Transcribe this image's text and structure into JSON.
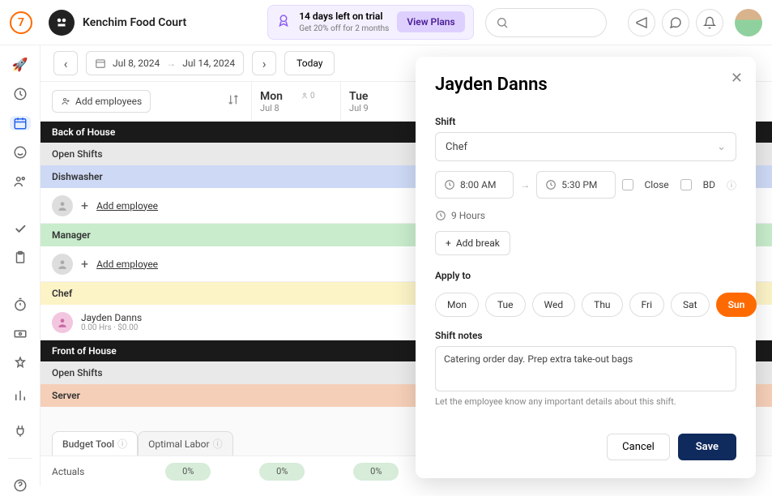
{
  "brand": "Kenchim Food Court",
  "trial": {
    "line1": "14 days left on trial",
    "line2": "Get 20% off for 2 months",
    "cta": "View Plans"
  },
  "date_range": {
    "from": "Jul 8, 2024",
    "to": "Jul 14, 2024"
  },
  "today_label": "Today",
  "add_employees_label": "Add employees",
  "days": [
    {
      "name": "Mon",
      "date": "Jul 8",
      "count": "0"
    },
    {
      "name": "Tue",
      "date": "Jul 9",
      "count": ""
    }
  ],
  "sections": {
    "back": "Back of House",
    "open": "Open Shifts",
    "dish": "Dishwasher",
    "mgr": "Manager",
    "chef": "Chef",
    "front": "Front of House",
    "srv": "Server"
  },
  "add_employee_link": "Add employee",
  "employee": {
    "name": "Jayden Danns",
    "meta": "0.00 Hrs · $0.00"
  },
  "bottom_tabs": {
    "budget": "Budget Tool",
    "optimal": "Optimal Labor"
  },
  "actuals": {
    "label": "Actuals",
    "pct": "0%"
  },
  "panel": {
    "title": "Jayden Danns",
    "shift_label": "Shift",
    "shift_value": "Chef",
    "time_from": "8:00 AM",
    "time_to": "5:30 PM",
    "close_label": "Close",
    "bd_label": "BD",
    "hours": "9 Hours",
    "add_break": "Add break",
    "apply_label": "Apply to",
    "days": [
      "Mon",
      "Tue",
      "Wed",
      "Thu",
      "Fri",
      "Sat",
      "Sun"
    ],
    "selected_day_index": 6,
    "notes_label": "Shift notes",
    "notes_value": "Catering order day. Prep extra take-out bags",
    "helper": "Let the employee know any important details about this shift.",
    "cancel": "Cancel",
    "save": "Save"
  }
}
